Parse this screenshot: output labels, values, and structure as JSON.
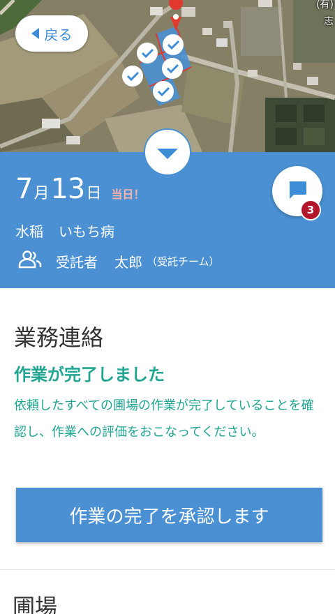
{
  "map": {
    "back_label": "戻る",
    "label_top": "(有)",
    "label_bottom": "志"
  },
  "header": {
    "month": "7",
    "month_unit": "月",
    "day": "13",
    "day_unit": "日",
    "today_label": "当日！",
    "crop": "水稲",
    "disease": "いもち病",
    "contractor_label": "受託者",
    "contractor_name": "太郎",
    "contractor_team": "（受託チーム）",
    "chat_badge": "3",
    "accent_color": "#4a90d2"
  },
  "notice": {
    "section_title": "業務連絡",
    "headline": "作業が完了しました",
    "message": "依頼したすべての圃場の作業が完了していることを確認し、作業への評価をおこなってください。",
    "approve_label": "作業の完了を承認します",
    "text_color": "#1fa591"
  },
  "fields": {
    "section_title": "圃場"
  }
}
